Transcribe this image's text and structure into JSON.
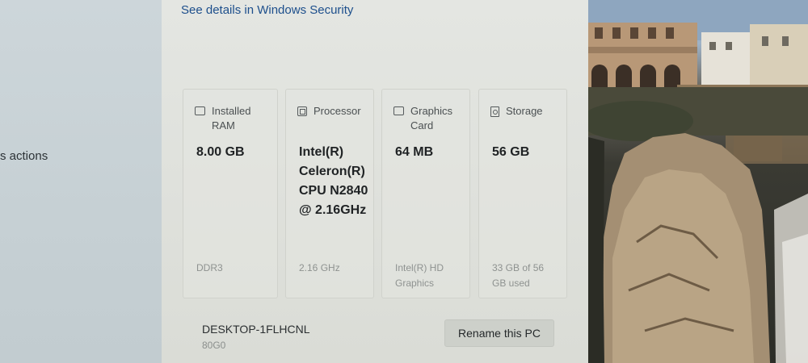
{
  "left_pane": {
    "actions_text": "s actions"
  },
  "content": {
    "security_link": "See details in Windows Security",
    "specs": [
      {
        "icon": "memory-icon",
        "label": "Installed RAM",
        "value": "8.00 GB",
        "sub": "DDR3"
      },
      {
        "icon": "processor-icon",
        "label": "Processor",
        "value": "Intel(R) Celeron(R) CPU N2840 @ 2.16GHz",
        "sub": "2.16 GHz"
      },
      {
        "icon": "graphics-card-icon",
        "label": "Graphics Card",
        "value": "64 MB",
        "sub": "Intel(R) HD Graphics"
      },
      {
        "icon": "storage-icon",
        "label": "Storage",
        "value": "56 GB",
        "sub": "33 GB of 56 GB used"
      }
    ],
    "device_name": "DESKTOP-1FLHCNL",
    "device_model": "80G0",
    "rename_button": "Rename this PC"
  }
}
